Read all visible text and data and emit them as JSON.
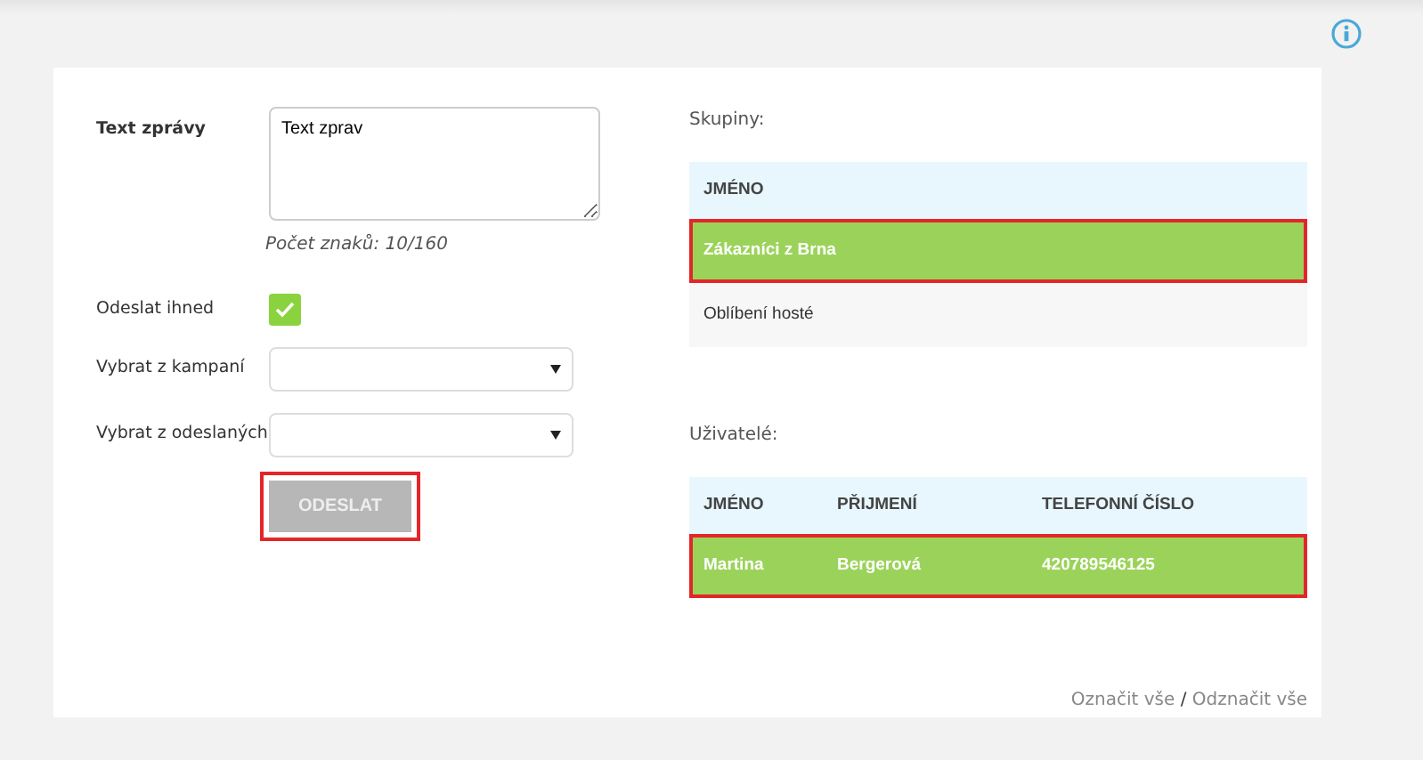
{
  "message": {
    "label": "Text zprávy",
    "value": "Text zprav",
    "counter": "Počet znaků: 10/160"
  },
  "send_now": {
    "label": "Odeslat ihned",
    "checked": true
  },
  "selects": [
    {
      "label": "Vybrat z kampaní"
    },
    {
      "label": "Vybrat z odeslaných"
    }
  ],
  "send_button": {
    "label": "ODESLAT",
    "disabled": true,
    "highlighted": true
  },
  "groups": {
    "title": "Skupiny:",
    "columns": [
      "JMÉNO"
    ],
    "rows": [
      {
        "cells": [
          "Zákazníci z Brna"
        ],
        "selected": true
      },
      {
        "cells": [
          "Oblíbení hosté"
        ],
        "selected": false
      }
    ]
  },
  "users": {
    "title": "Uživatelé:",
    "columns": [
      "JMÉNO",
      "PŘIJMENÍ",
      "TELEFONNÍ ČÍSLO"
    ],
    "rows": [
      {
        "cells": [
          "Martina",
          "Bergerová",
          "420789546125"
        ],
        "selected": true
      }
    ]
  },
  "select_all": "Označit vše",
  "separator": "/",
  "deselect_all": "Odznačit vše"
}
